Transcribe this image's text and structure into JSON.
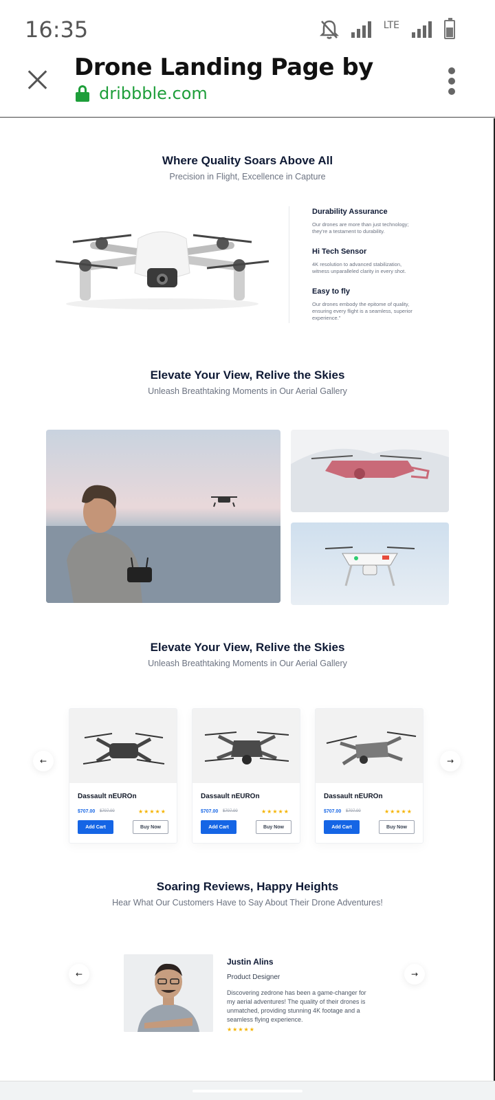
{
  "status": {
    "time": "16:35",
    "network": "LTE"
  },
  "browser": {
    "title": "Drone Landing Page by",
    "url": "dribbble.com",
    "lock_color": "#1e9e3a"
  },
  "section_quality": {
    "title": "Where Quality Soars Above All",
    "subtitle": "Precision in Flight, Excellence in Capture",
    "features": [
      {
        "title": "Durability Assurance",
        "desc": "Our drones are more than just technology; they're a testament to durability."
      },
      {
        "title": "Hi Tech Sensor",
        "desc": "4K resolution to advanced stabilization, witness unparalleled clarity in every shot."
      },
      {
        "title": "Easy to fly",
        "desc": "Our drones embody the epitome of quality, ensuring every flight is a seamless, superior experience.\""
      }
    ]
  },
  "section_gallery": {
    "title": "Elevate Your View, Relive the Skies",
    "subtitle": "Unleash Breathtaking Moments in Our Aerial Gallery"
  },
  "section_products": {
    "title": "Elevate Your View, Relive the Skies",
    "subtitle": "Unleash Breathtaking Moments in Our Aerial Gallery",
    "prev": "←",
    "next": "→",
    "products": [
      {
        "name": "Dassault nEUROn",
        "price": "$707.00",
        "old_price": "$707.00",
        "rating": 5,
        "stars": "★★★★★",
        "add_label": "Add Cart",
        "buy_label": "Buy Now"
      },
      {
        "name": "Dassault nEUROn",
        "price": "$707.00",
        "old_price": "$707.00",
        "rating": 5,
        "stars": "★★★★★",
        "add_label": "Add Cart",
        "buy_label": "Buy Now"
      },
      {
        "name": "Dassault nEUROn",
        "price": "$707.00",
        "old_price": "$707.00",
        "rating": 5,
        "stars": "★★★★★",
        "add_label": "Add Cart",
        "buy_label": "Buy Now"
      }
    ]
  },
  "section_reviews": {
    "title": "Soaring Reviews, Happy Heights",
    "subtitle": "Hear What Our Customers Have to Say About Their Drone Adventures!",
    "prev": "←",
    "next": "→",
    "review": {
      "name": "Justin Alins",
      "role": "Product Designer",
      "text": "Discovering zedrone has been a game-changer for my aerial adventures! The quality of their drones is unmatched, providing stunning 4K footage and a seamless flying experience.",
      "rating": 5,
      "stars": "★★★★★"
    }
  },
  "colors": {
    "accent": "#1565e5",
    "heading": "#0f1a35",
    "star": "#f5b300"
  }
}
